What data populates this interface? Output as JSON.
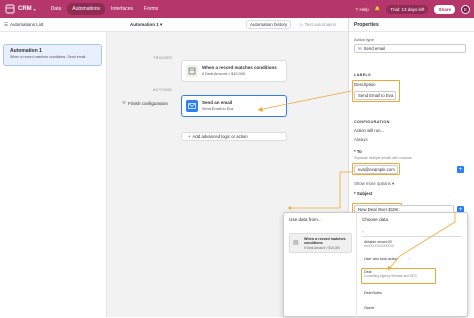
{
  "topbar": {
    "app_name": "CRM",
    "nav": [
      "Data",
      "Automations",
      "Interfaces",
      "Forms"
    ],
    "help": "Help",
    "trial": "Trial: 13 days left",
    "share": "Share",
    "avatar": "E"
  },
  "toolbar": {
    "automations_list": "Automations List",
    "title": "Automation 1",
    "history": "Automation history",
    "test": "Test automation"
  },
  "sidebar": {
    "card_title": "Automation 1",
    "card_sub": "When a record matches conditions, Send email"
  },
  "canvas": {
    "trigger_label": "TRIGGER",
    "actions_label": "ACTIONS",
    "trigger_title": "When a record matches conditions",
    "trigger_sub": "If Deal Amount > $10,000",
    "action_title": "Send an email",
    "action_sub": "Send Email to Eva",
    "finish": "Finish configuration",
    "add": "Add advanced logic or action"
  },
  "panel": {
    "header": "Properties",
    "action_type_label": "Action type",
    "action_type_value": "Send email",
    "labels_section": "LABELS",
    "description_label": "Description",
    "description_value": "Send Email to Eva",
    "configuration_section": "CONFIGURATION",
    "action_will_run": "Action will run...",
    "always": "Always",
    "to_label": "To",
    "to_hint": "Separate multiple emails with commas",
    "to_value": "eva@example.com",
    "show_more": "Show more options",
    "subject_label": "Subject",
    "subject_value": "New Deal Over $10K:"
  },
  "dialog": {
    "use_data_from": "Use data from...",
    "choose_data": "Choose data",
    "mini_title": "When a record matches conditions",
    "mini_sub": "If Deal Amount > $10,000",
    "items": [
      {
        "label": "Airtable record ID",
        "sub": "recXXXXXXXXXXXX"
      },
      {
        "label": "User who took action",
        "sub": ""
      },
      {
        "label": "Deal",
        "sub": "Consulting Agency Website and SEO"
      },
      {
        "label": "Deal Notes",
        "sub": ""
      },
      {
        "label": "Owner",
        "sub": ""
      }
    ]
  }
}
